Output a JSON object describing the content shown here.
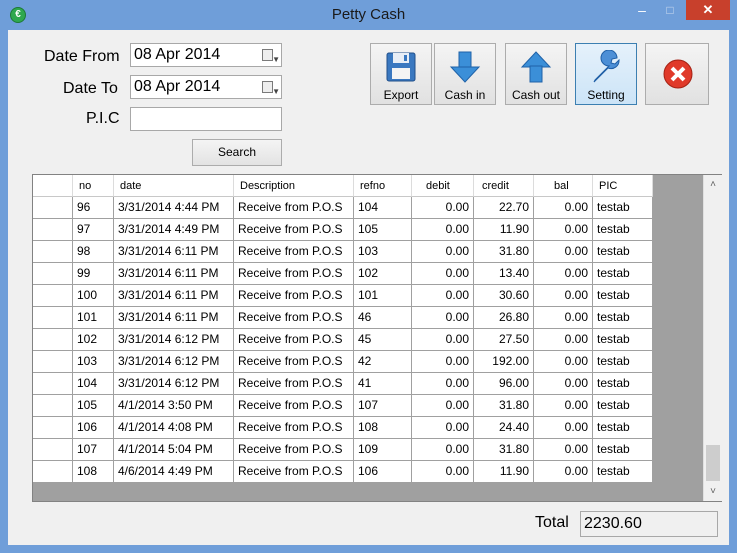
{
  "window": {
    "title": "Petty Cash",
    "icon_letter": "€",
    "min": "–",
    "max": "□",
    "close": "✕"
  },
  "filters": {
    "date_from_label": "Date From",
    "date_from_value": "08 Apr 2014",
    "date_to_label": "Date To",
    "date_to_value": "08 Apr 2014",
    "pic_label": "P.I.C",
    "pic_value": "",
    "search_label": "Search"
  },
  "toolbar": {
    "export": "Export",
    "cash_in": "Cash in",
    "cash_out": "Cash out",
    "setting": "Setting"
  },
  "table": {
    "columns": [
      "no",
      "date",
      "Description",
      "refno",
      "debit",
      "credit",
      "bal",
      "PIC"
    ],
    "rows": [
      [
        "96",
        "3/31/2014 4:44 PM",
        "Receive from P.O.S",
        "104",
        "0.00",
        "22.70",
        "0.00",
        "testab"
      ],
      [
        "97",
        "3/31/2014 4:49 PM",
        "Receive from P.O.S",
        "105",
        "0.00",
        "11.90",
        "0.00",
        "testab"
      ],
      [
        "98",
        "3/31/2014 6:11 PM",
        "Receive from P.O.S",
        "103",
        "0.00",
        "31.80",
        "0.00",
        "testab"
      ],
      [
        "99",
        "3/31/2014 6:11 PM",
        "Receive from P.O.S",
        "102",
        "0.00",
        "13.40",
        "0.00",
        "testab"
      ],
      [
        "100",
        "3/31/2014 6:11 PM",
        "Receive from P.O.S",
        "101",
        "0.00",
        "30.60",
        "0.00",
        "testab"
      ],
      [
        "101",
        "3/31/2014 6:11 PM",
        "Receive from P.O.S",
        "46",
        "0.00",
        "26.80",
        "0.00",
        "testab"
      ],
      [
        "102",
        "3/31/2014 6:12 PM",
        "Receive from P.O.S",
        "45",
        "0.00",
        "27.50",
        "0.00",
        "testab"
      ],
      [
        "103",
        "3/31/2014 6:12 PM",
        "Receive from P.O.S",
        "42",
        "0.00",
        "192.00",
        "0.00",
        "testab"
      ],
      [
        "104",
        "3/31/2014 6:12 PM",
        "Receive from P.O.S",
        "41",
        "0.00",
        "96.00",
        "0.00",
        "testab"
      ],
      [
        "105",
        "4/1/2014 3:50 PM",
        "Receive from P.O.S",
        "107",
        "0.00",
        "31.80",
        "0.00",
        "testab"
      ],
      [
        "106",
        "4/1/2014 4:08 PM",
        "Receive from P.O.S",
        "108",
        "0.00",
        "24.40",
        "0.00",
        "testab"
      ],
      [
        "107",
        "4/1/2014 5:04 PM",
        "Receive from P.O.S",
        "109",
        "0.00",
        "31.80",
        "0.00",
        "testab"
      ],
      [
        "108",
        "4/6/2014 4:49 PM",
        "Receive from P.O.S",
        "106",
        "0.00",
        "11.90",
        "0.00",
        "testab"
      ]
    ],
    "scroll_up": "˄",
    "scroll_down": "˅"
  },
  "footer": {
    "total_label": "Total",
    "total_value": "2230.60"
  }
}
